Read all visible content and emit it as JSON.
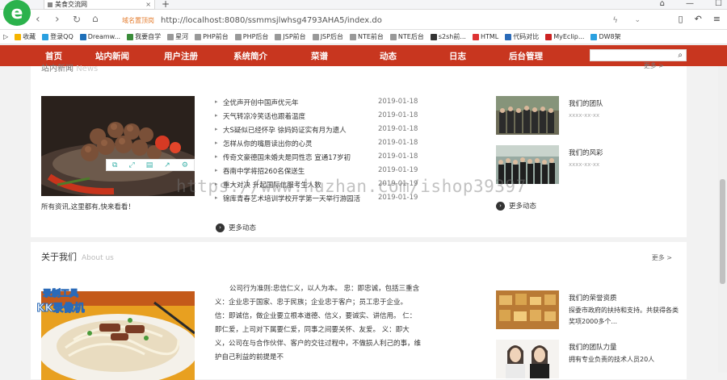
{
  "browser": {
    "logo": "e",
    "tab_title": "美食交流网",
    "tab_close": "×",
    "new_tab": "+",
    "ssl_label": "域名置顶岗",
    "url": "http://localhost:8080/ssmmsjlwhsg4793AHA5/index.do",
    "bookmarks": [
      {
        "label": "收藏",
        "color": "#f5b400"
      },
      {
        "label": "登录QQ",
        "color": "#2aa0e0"
      },
      {
        "label": "Dreamw...",
        "color": "#1d6fb8"
      },
      {
        "label": "我要自学",
        "color": "#3a8c3a"
      },
      {
        "label": "星河",
        "color": "#999999"
      },
      {
        "label": "PHP前台",
        "color": "#999999"
      },
      {
        "label": "PHP后台",
        "color": "#999999"
      },
      {
        "label": "JSP前台",
        "color": "#999999"
      },
      {
        "label": "JSP后台",
        "color": "#999999"
      },
      {
        "label": "NTE前台",
        "color": "#999999"
      },
      {
        "label": "NTE后台",
        "color": "#999999"
      },
      {
        "label": "s2sh前...",
        "color": "#333333"
      },
      {
        "label": "HTML",
        "color": "#d33"
      },
      {
        "label": "代码对比",
        "color": "#2a6ab8"
      },
      {
        "label": "MyEclip...",
        "color": "#c22"
      },
      {
        "label": "DW8架",
        "color": "#2aa0e0"
      }
    ]
  },
  "site_nav": {
    "items": [
      "首页",
      "站内新闻",
      "用户注册",
      "系统简介",
      "菜谱",
      "动态",
      "日志",
      "后台管理"
    ],
    "search_placeholder": ""
  },
  "news_section": {
    "title_cut": "站内新闻",
    "title_en_cut": "News",
    "more_cut": "更多 >",
    "items": [
      {
        "title": "全优声开创中国声优元年",
        "date": "2019-01-18"
      },
      {
        "title": "天气转凉冷笑话也跟着温度",
        "date": "2019-01-18"
      },
      {
        "title": "大S疑似已经怀孕 徐妈妈证实有月为遗人",
        "date": "2019-01-18"
      },
      {
        "title": "怎样从你的嘴唇读出你的心灵",
        "date": "2019-01-18"
      },
      {
        "title": "传奇文豪德国未婚夫是同性恋 宣通17岁初",
        "date": "2019-01-18"
      },
      {
        "title": "吞南中学将招260名保送生",
        "date": "2019-01-19"
      },
      {
        "title": "重大对决 升起国际信服考生人数",
        "date": "2019-01-19"
      },
      {
        "title": "锦库青春艺术培训学校开学第一天举行游园活",
        "date": "2019-01-19"
      }
    ],
    "caption": "所有资讯,这里都有,快来看看！",
    "more_news": "更多动态",
    "side": [
      {
        "title": "我们的团队",
        "sub": "xxxx-xx-xx"
      },
      {
        "title": "我们的风彩",
        "sub": "xxxx-xx-xx"
      }
    ],
    "side_more": "更多动态"
  },
  "about_section": {
    "title": "关于我们",
    "title_en": "About us",
    "more": "更多 >",
    "text": "公司行为准则:忠信仁义，以人为本。 忠：即忠诚，包括三重含义：企业忠于国家、忠于民族；企业忠于客户；员工忠于企业。 信：即诚信，做企业要立根本道德、信义，要诚实、讲信用。 仁：即仁爱，上司对下属要仁爱，同事之间要关怀、友爱。 义：即大义，公司在与合作伙伴、客户的交往过程中，不做损人利己的事，维护自己利益的前提是不",
    "side": [
      {
        "title": "我们的荣誉资质",
        "text": "探委市政府的扶持和支持。共获得各类奖项2000多个..."
      },
      {
        "title": "我们的团队力量",
        "text": "拥有专业负责的技术人员20人"
      }
    ]
  },
  "watermark": "https://www.huzhan.com/ishop39397",
  "recorder": {
    "line1": "录制工具",
    "line2": "KK录像机"
  },
  "colors": {
    "nav_red": "#c8361f",
    "accent_green": "#2bb24c"
  }
}
